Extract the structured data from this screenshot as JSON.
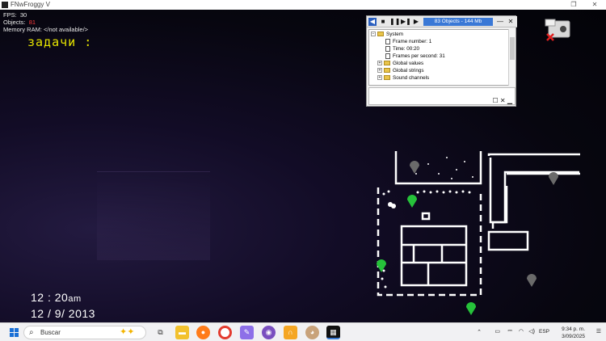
{
  "window": {
    "title": "FNwFroggy V",
    "restore_icon": "restore-icon",
    "close_icon": "close-icon"
  },
  "debug": {
    "fps_label": "FPS:",
    "fps_value": "30",
    "objects_label": "Objects:",
    "objects_value": "81",
    "memory_label": "Memory RAM:",
    "memory_value": "</not available/>"
  },
  "tasks_label": "задачи :",
  "clock": {
    "time": "12 : 20",
    "ampm": "am",
    "date": "12 /   9/ 2013"
  },
  "debugger": {
    "objects_info": "83 Objects - 144 Mb",
    "tree": [
      {
        "label": "System",
        "type": "folder",
        "expander": "−"
      },
      {
        "label": "Frame number: 1",
        "type": "item"
      },
      {
        "label": "Time: 00:20",
        "type": "item"
      },
      {
        "label": "Frames per second: 31",
        "type": "item"
      },
      {
        "label": "Global values",
        "type": "folder",
        "expander": "+"
      },
      {
        "label": "Global strings",
        "type": "folder",
        "expander": "+"
      },
      {
        "label": "Sound channels",
        "type": "folder",
        "expander": "+"
      }
    ],
    "minimize_glyph": "—",
    "close_glyph": "✕"
  },
  "map": {
    "cameras": [
      {
        "id": "cam-top-stage",
        "state": "inactive"
      },
      {
        "id": "cam-right-hall",
        "state": "inactive"
      },
      {
        "id": "cam-center",
        "state": "active"
      },
      {
        "id": "cam-left-hall",
        "state": "active"
      },
      {
        "id": "cam-right-lower",
        "state": "inactive"
      },
      {
        "id": "cam-office",
        "state": "active"
      }
    ]
  },
  "camera_disabled_icon": "camera-off-icon",
  "taskbar": {
    "search_placeholder": "Buscar",
    "apps": [
      "task-view-icon",
      "file-explorer-icon",
      "firefox-icon",
      "chrome-icon",
      "notepad-icon",
      "tor-icon",
      "headphones-app-icon",
      "gimp-icon",
      "game-window-icon"
    ],
    "tray": {
      "language": "ESP",
      "time": "9:34 p. m.",
      "date": "3/09/2025"
    }
  },
  "colors": {
    "task_text": "#e6e400",
    "map_line": "#ffffff",
    "cam_active": "#26c23a",
    "cam_inactive": "#6a6a6a",
    "debugger_highlight": "#3a78d6"
  }
}
